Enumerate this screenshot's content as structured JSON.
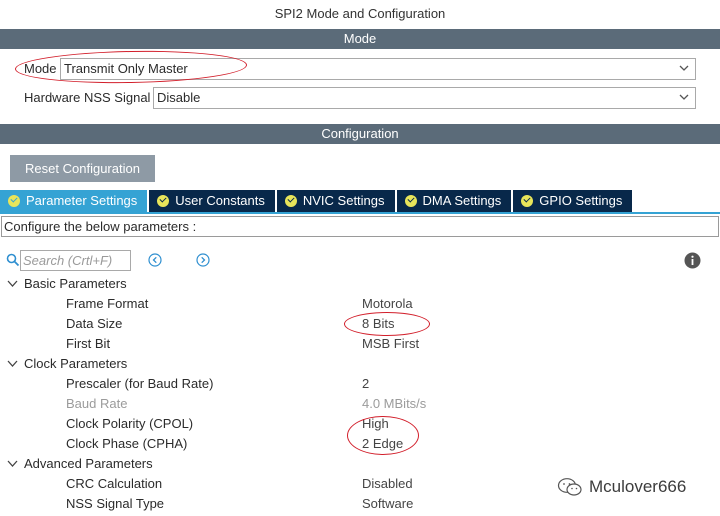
{
  "window": {
    "title": "SPI2 Mode and Configuration"
  },
  "mode_section": {
    "header": "Mode",
    "mode": {
      "label": "Mode",
      "value": "Transmit Only Master"
    },
    "nss": {
      "label": "Hardware NSS Signal",
      "value": "Disable"
    }
  },
  "config_section": {
    "header": "Configuration",
    "reset_label": "Reset Configuration",
    "tabs": [
      {
        "label": "Parameter Settings",
        "active": true
      },
      {
        "label": "User Constants",
        "active": false
      },
      {
        "label": "NVIC Settings",
        "active": false
      },
      {
        "label": "DMA Settings",
        "active": false
      },
      {
        "label": "GPIO Settings",
        "active": false
      }
    ],
    "configure_text": "Configure the below parameters :",
    "search": {
      "placeholder": "Search (Crtl+F)"
    }
  },
  "parameters": {
    "basic": {
      "label": "Basic Parameters",
      "items": [
        {
          "name": "Frame Format",
          "value": "Motorola"
        },
        {
          "name": "Data Size",
          "value": "8 Bits"
        },
        {
          "name": "First Bit",
          "value": "MSB First"
        }
      ]
    },
    "clock": {
      "label": "Clock Parameters",
      "items": [
        {
          "name": "Prescaler (for Baud Rate)",
          "value": "2"
        },
        {
          "name": "Baud Rate",
          "value": "4.0 MBits/s"
        },
        {
          "name": "Clock Polarity (CPOL)",
          "value": "High"
        },
        {
          "name": "Clock Phase (CPHA)",
          "value": "2 Edge"
        }
      ]
    },
    "advanced": {
      "label": "Advanced Parameters",
      "items": [
        {
          "name": "CRC Calculation",
          "value": "Disabled"
        },
        {
          "name": "NSS Signal Type",
          "value": "Software"
        }
      ]
    }
  },
  "watermark": {
    "text": "Mculover666"
  },
  "colors": {
    "section_bar": "#5b6b79",
    "tab_active": "#35a3d4",
    "tab_inactive": "#08284a",
    "check_badge": "#e8e55a",
    "annotation": "#d21f2b"
  }
}
